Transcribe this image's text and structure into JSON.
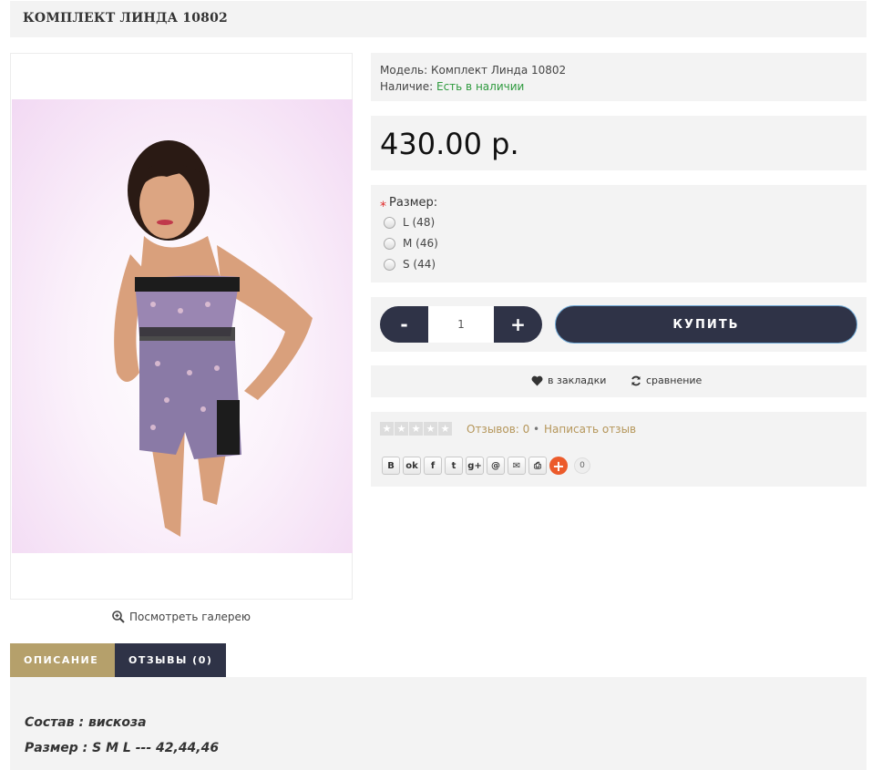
{
  "product": {
    "title": "КОМПЛЕКТ ЛИНДА 10802",
    "model_label": "Модель:",
    "model_value": "Комплект Линда 10802",
    "availability_label": "Наличие:",
    "availability_value": "Есть в наличии",
    "price": "430.00 р."
  },
  "gallery": {
    "link_label": "Посмотреть галерею",
    "icon": "zoom-in-icon"
  },
  "options": {
    "label": "Размер:",
    "required_mark": "*",
    "items": [
      {
        "label": "L (48)"
      },
      {
        "label": "M (46)"
      },
      {
        "label": "S (44)"
      }
    ]
  },
  "cart": {
    "minus": "-",
    "quantity": "1",
    "plus": "+",
    "buy_label": "КУПИТЬ"
  },
  "actions": {
    "wishlist": "в закладки",
    "compare": "сравнение"
  },
  "reviews": {
    "count_label": "Отзывов: 0",
    "separator": "•",
    "write_label": "Написать отзыв",
    "rating": 0,
    "max_rating": 5
  },
  "share": {
    "buttons": [
      {
        "name": "vk-share-button",
        "glyph": "B"
      },
      {
        "name": "odnoklassniki-share-button",
        "glyph": "ok"
      },
      {
        "name": "facebook-share-button",
        "glyph": "f"
      },
      {
        "name": "twitter-share-button",
        "glyph": "t"
      },
      {
        "name": "google-plus-share-button",
        "glyph": "g+"
      },
      {
        "name": "mailru-share-button",
        "glyph": "@"
      },
      {
        "name": "email-share-button",
        "glyph": "✉"
      },
      {
        "name": "print-button",
        "glyph": "⎙"
      }
    ],
    "more": "+",
    "counter": "0"
  },
  "tabs": [
    {
      "label": "ОПИСАНИЕ",
      "active": true
    },
    {
      "label": "ОТЗЫВЫ (0)",
      "active": false
    }
  ],
  "description": {
    "line1": "Состав : вискоза",
    "line2": "Размер : S M L --- 42,44,46"
  },
  "colors": {
    "accent_gold": "#b5a06b",
    "dark_navy": "#2f3347",
    "in_stock_green": "#2e9a3e",
    "panel_bg": "#f3f3f3",
    "share_more": "#ec5b2b"
  }
}
